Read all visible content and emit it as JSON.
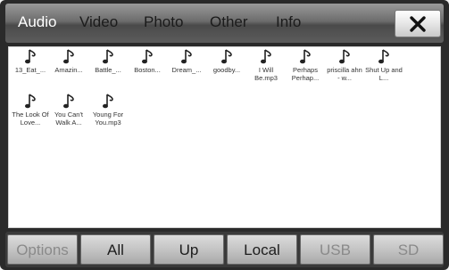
{
  "tabs": [
    "Audio",
    "Video",
    "Photo",
    "Other",
    "Info"
  ],
  "active_tab": "Audio",
  "close_icon": "close-icon",
  "files": [
    {
      "name": "13_Eat_...",
      "icon": "music-note-icon"
    },
    {
      "name": "Amazin...",
      "icon": "music-note-icon"
    },
    {
      "name": "Battle_...",
      "icon": "music-note-icon"
    },
    {
      "name": "Boston...",
      "icon": "music-note-icon"
    },
    {
      "name": "Dream_...",
      "icon": "music-note-icon"
    },
    {
      "name": "goodby...",
      "icon": "music-note-icon"
    },
    {
      "name": "I Will Be.mp3",
      "icon": "music-note-icon"
    },
    {
      "name": "Perhaps Perhap...",
      "icon": "music-note-icon"
    },
    {
      "name": "priscilla ahn - w...",
      "icon": "music-note-icon"
    },
    {
      "name": "Shut Up and L...",
      "icon": "music-note-icon"
    },
    {
      "name": "The Look Of Love...",
      "icon": "music-note-icon"
    },
    {
      "name": "You Can't Walk A...",
      "icon": "music-note-icon"
    },
    {
      "name": "Young For You.mp3",
      "icon": "music-note-icon"
    }
  ],
  "bottom_buttons": [
    {
      "label": "Options",
      "enabled": false
    },
    {
      "label": "All",
      "enabled": true
    },
    {
      "label": "Up",
      "enabled": true
    },
    {
      "label": "Local",
      "enabled": true
    },
    {
      "label": "USB",
      "enabled": false
    },
    {
      "label": "SD",
      "enabled": false
    }
  ]
}
